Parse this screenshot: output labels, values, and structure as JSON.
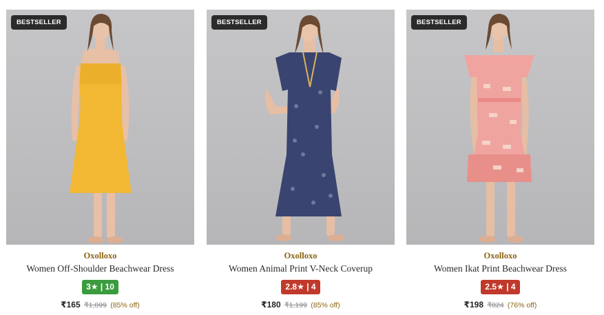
{
  "products": [
    {
      "badge": "BESTSELLER",
      "brand": "Oxolloxo",
      "title": "Women Off-Shoulder Beachwear Dress",
      "rating": "3★ | 10",
      "rating_color": "#3a9c3e",
      "price": "₹165",
      "mrp": "₹1,099",
      "discount": "(85% off)",
      "dress_color": "#f2b833"
    },
    {
      "badge": "BESTSELLER",
      "brand": "Oxolloxo",
      "title": "Women Animal Print V-Neck Coverup",
      "rating": "2.8★ | 4",
      "rating_color": "#c0392b",
      "price": "₹180",
      "mrp": "₹1,199",
      "discount": "(85% off)",
      "dress_color": "#3a4470"
    },
    {
      "badge": "BESTSELLER",
      "brand": "Oxolloxo",
      "title": "Women Ikat Print Beachwear Dress",
      "rating": "2.5★ | 4",
      "rating_color": "#c0392b",
      "price": "₹198",
      "mrp": "₹824",
      "discount": "(76% off)",
      "dress_color": "#f0a4a0"
    }
  ]
}
